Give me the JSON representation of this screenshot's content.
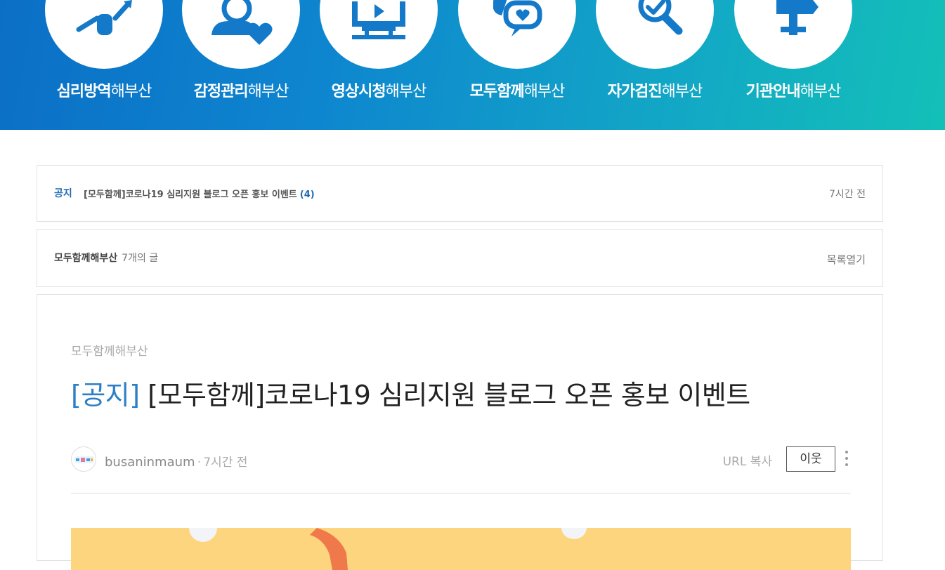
{
  "categories": [
    {
      "bold": "심리방역",
      "suffix": "해부산",
      "icon": "person-arrow-icon"
    },
    {
      "bold": "감정관리",
      "suffix": "해부산",
      "icon": "person-heart-icon"
    },
    {
      "bold": "영상시청",
      "suffix": "해부산",
      "icon": "monitor-play-icon"
    },
    {
      "bold": "모두함께",
      "suffix": "해부산",
      "icon": "chat-heart-icon"
    },
    {
      "bold": "자가검진",
      "suffix": "해부산",
      "icon": "magnifier-check-icon"
    },
    {
      "bold": "기관안내",
      "suffix": "해부산",
      "icon": "signpost-icon"
    }
  ],
  "notice": {
    "tag": "공지",
    "title": "[모두함께]코로나19 심리지원 블로그 오픈 홍보 이벤트",
    "comment_count": "(4)",
    "time": "7시간 전"
  },
  "category_list": {
    "name": "모두함께해부산",
    "count": "7개의 글",
    "open_label": "목록열기"
  },
  "post": {
    "category": "모두함께해부산",
    "title_prefix": "[공지]",
    "title": "[모두함께]코로나19 심리지원 블로그 오픈 홍보 이벤트",
    "author": "busaninmaum",
    "separator": "·",
    "time": "7시간 전",
    "url_copy": "URL 복사",
    "neighbor": "이웃"
  },
  "colors": {
    "banner_start": "#0b6fc6",
    "banner_end": "#13c0b8",
    "accent": "#2c7fc7",
    "icon_blue": "#1479c9"
  }
}
